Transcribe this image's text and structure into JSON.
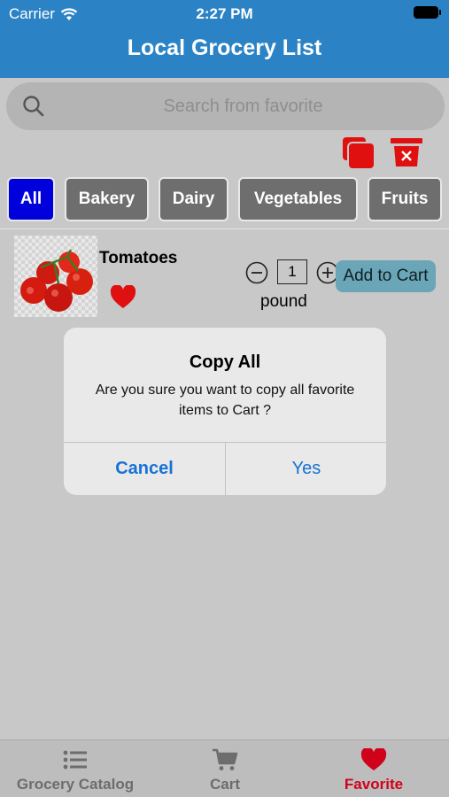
{
  "status_bar": {
    "carrier": "Carrier",
    "time": "2:27 PM"
  },
  "header": {
    "title": "Local Grocery List"
  },
  "search": {
    "placeholder": "Search from favorite",
    "value": ""
  },
  "toolbar": {
    "copy_icon": "copy-all-icon",
    "delete_icon": "delete-all-icon"
  },
  "categories": [
    {
      "label": "All",
      "active": true
    },
    {
      "label": "Bakery",
      "active": false
    },
    {
      "label": "Dairy",
      "active": false
    },
    {
      "label": "Vegetables",
      "active": false
    },
    {
      "label": "Fruits",
      "active": false
    }
  ],
  "items": [
    {
      "name": "Tomatoes",
      "quantity": "1",
      "unit": "pound",
      "add_label": "Add to Cart",
      "favorite": true
    }
  ],
  "dialog": {
    "title": "Copy All",
    "message": "Are you sure you want to copy all favorite items to Cart ?",
    "cancel_label": "Cancel",
    "confirm_label": "Yes"
  },
  "tabs": [
    {
      "label": "Grocery Catalog",
      "icon": "list-icon",
      "active": false
    },
    {
      "label": "Cart",
      "icon": "cart-icon",
      "active": false
    },
    {
      "label": "Favorite",
      "icon": "heart-icon",
      "active": true
    }
  ],
  "colors": {
    "header": "#2b83c6",
    "active_category": "#0000dd",
    "accent_red": "#e01010",
    "dialog_button": "#1672d6",
    "active_tab": "#d0021b"
  }
}
